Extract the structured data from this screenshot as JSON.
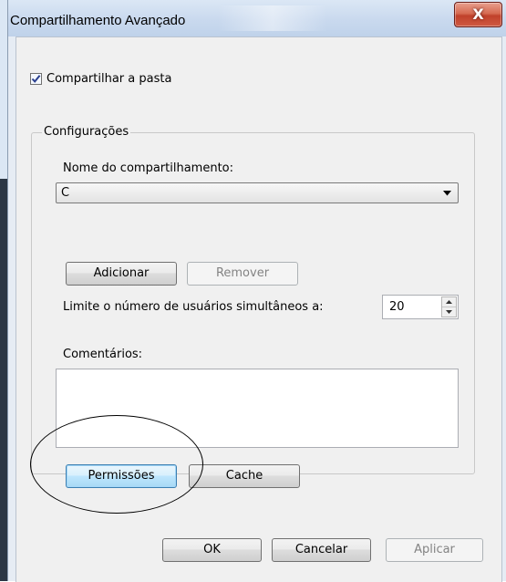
{
  "window": {
    "title": "Compartilhamento Avançado",
    "close_glyph": "X"
  },
  "share_folder": {
    "label": "Compartilhar a pasta",
    "checked": true
  },
  "settings_group": {
    "legend": "Configurações",
    "share_name_label": "Nome do compartilhamento:",
    "share_name_value": "C",
    "add_button": "Adicionar",
    "remove_button": "Remover",
    "limit_label": "Limite o número de usuários simultâneos a:",
    "limit_value": "20",
    "comments_label": "Comentários:",
    "comments_value": "",
    "permissions_button": "Permissões",
    "cache_button": "Cache"
  },
  "footer": {
    "ok_button": "OK",
    "cancel_button": "Cancelar",
    "apply_button": "Aplicar"
  },
  "colors": {
    "close_button": "#c0412b",
    "focus_border": "#3c7fb1"
  },
  "icons": [
    "close-icon",
    "checkmark-icon",
    "dropdown-arrow-icon",
    "spin-up-icon",
    "spin-down-icon"
  ]
}
